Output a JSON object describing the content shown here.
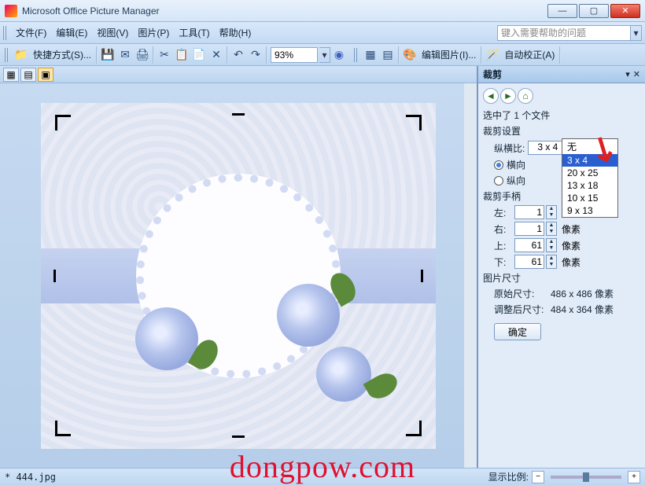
{
  "title": "Microsoft Office Picture Manager",
  "menu": {
    "file": "文件(F)",
    "edit": "编辑(E)",
    "view": "视图(V)",
    "picture": "图片(P)",
    "tools": "工具(T)",
    "help": "帮助(H)"
  },
  "help_placeholder": "键入需要帮助的问题",
  "toolbar": {
    "shortcut": "快捷方式(S)...",
    "zoom_value": "93%",
    "edit_picture": "编辑图片(I)...",
    "auto_correct": "自动校正(A)"
  },
  "taskpane": {
    "title": "裁剪",
    "selected": "选中了 1 个文件",
    "settings_title": "裁剪设置",
    "aspect_label": "纵横比:",
    "aspect_value": "3 x 4",
    "landscape": "横向",
    "portrait": "纵向",
    "ratio_options": [
      "无",
      "3 x 4",
      "20 x 25",
      "13 x 18",
      "10 x 15",
      "9 x 13"
    ],
    "handles_title": "裁剪手柄",
    "left_label": "左:",
    "left_val": "1",
    "right_label": "右:",
    "right_val": "1",
    "top_label": "上:",
    "top_val": "61",
    "bottom_label": "下:",
    "bottom_val": "61",
    "unit": "像素",
    "size_title": "图片尺寸",
    "orig_label": "原始尺寸:",
    "orig_val": "486 x 486 像素",
    "new_label": "调整后尺寸:",
    "new_val": "484 x 364 像素",
    "ok": "确定"
  },
  "status": {
    "filename": "* 444.jpg",
    "zoom_label": "显示比例:"
  },
  "watermark": "dongpow.com"
}
